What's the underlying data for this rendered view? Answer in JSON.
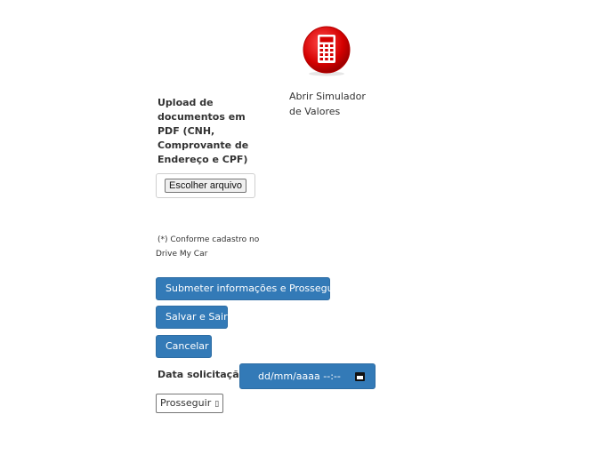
{
  "simulator": {
    "icon": "calculator-icon",
    "label_line1": "Abrir Simulador",
    "label_line2": "de Valores"
  },
  "upload": {
    "label_lines": [
      "Upload de",
      "documentos em",
      "PDF (CNH,",
      "Comprovante de",
      "Endereço e CPF)"
    ],
    "file_button": "Escolher arquivo"
  },
  "note": {
    "line1": "(*) Conforme cadastro no",
    "line2": "Drive My Car"
  },
  "buttons": {
    "submit": "Submeter informações e Prosseguir",
    "save": "Salvar e Sair",
    "cancel": "Cancelar"
  },
  "date": {
    "label": "Data solicitação:",
    "placeholder": "dd/mm/aaaa  --:--",
    "icon": "calendar-icon"
  },
  "proceed": {
    "label": "Prosseguir",
    "glyph": "▯"
  },
  "colors": {
    "primary": "#337ab7",
    "calculator_red": "#d40000"
  }
}
